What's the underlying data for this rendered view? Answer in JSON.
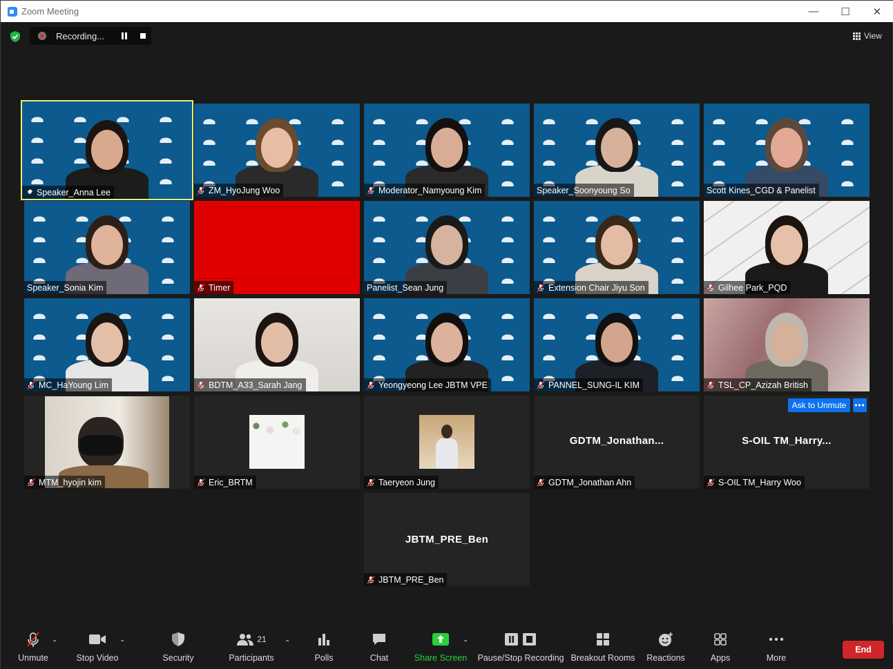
{
  "window": {
    "title": "Zoom Meeting"
  },
  "recording": {
    "label": "Recording..."
  },
  "view": {
    "label": "View"
  },
  "tiles": [
    {
      "name": "Speaker_Anna Lee",
      "bg": "pattern",
      "skin": "#d9a98d",
      "hair": "#1b1410",
      "shirt": "#1c1c1c",
      "active": true,
      "mic": "spotlight"
    },
    {
      "name": "ZM_HyoJung Woo",
      "bg": "pattern",
      "skin": "#e8bda5",
      "hair": "#6b4a30",
      "shirt": "#2a2a2a",
      "mic": "muted"
    },
    {
      "name": "Moderator_Namyoung Kim",
      "bg": "pattern",
      "skin": "#d8ad95",
      "hair": "#151010",
      "shirt": "#2a2a2a",
      "mic": "muted"
    },
    {
      "name": "Speaker_Soonyoung So",
      "bg": "pattern",
      "skin": "#d7b19a",
      "hair": "#181818",
      "shirt": "#d9d4c9",
      "mic": "none"
    },
    {
      "name": "Scott Kines_CGD & Panelist",
      "bg": "pattern",
      "skin": "#e3a994",
      "hair": "#5b4a3c",
      "shirt": "#344a66",
      "mic": "none"
    },
    {
      "name": "Speaker_Sonia Kim",
      "bg": "pattern",
      "skin": "#e0b49a",
      "hair": "#2b2018",
      "shirt": "#6e6a78",
      "mic": "none"
    },
    {
      "name": "Timer",
      "bg": "red",
      "mic": "muted"
    },
    {
      "name": "Panelist_Sean Jung",
      "bg": "pattern",
      "skin": "#d6b39e",
      "hair": "#1a1a1a",
      "shirt": "#3b3f45",
      "mic": "none"
    },
    {
      "name": "Extension Chair Jiyu Son",
      "bg": "pattern",
      "skin": "#e4bca4",
      "hair": "#3a2718",
      "shirt": "#d8d2c8",
      "mic": "muted"
    },
    {
      "name": "Gilhee Park_PQD",
      "bg": "white",
      "skin": "#e6c0aa",
      "hair": "#1b1410",
      "shirt": "#1a1a1a",
      "mic": "muted"
    },
    {
      "name": "MC_HaYoung Lim",
      "bg": "pattern",
      "skin": "#e4bfa7",
      "hair": "#1a1412",
      "shirt": "#e6e6e6",
      "mic": "muted"
    },
    {
      "name": "BDTM_A33_Sarah Jang",
      "bg": "room",
      "skin": "#e2bea6",
      "hair": "#1b1410",
      "shirt": "#f0eeea",
      "mic": "muted"
    },
    {
      "name": "Yeongyeong Lee JBTM VPE",
      "bg": "pattern",
      "skin": "#dcb29c",
      "hair": "#120e0d",
      "shirt": "#222222",
      "mic": "muted"
    },
    {
      "name": "PANNEL_SUNG-IL KIM",
      "bg": "pattern",
      "skin": "#d2a58c",
      "hair": "#111111",
      "shirt": "#1d2026",
      "mic": "muted"
    },
    {
      "name": "TSL_CP_Azizah British",
      "bg": "mall",
      "skin": "#d6b19a",
      "hair": "#bfb7ad",
      "shirt": "#6e6a60",
      "mic": "muted"
    },
    {
      "name": "MTM_hyojin kim",
      "bg": "thumb-big",
      "mic": "muted"
    },
    {
      "name": "Eric_BRTM",
      "bg": "thumb-flowers",
      "mic": "muted"
    },
    {
      "name": "Taeryeon Jung",
      "bg": "thumb-man",
      "mic": "muted"
    },
    {
      "name": "GDTM_Jonathan Ahn",
      "bg": "initials",
      "initials": "GDTM_Jonathan...",
      "mic": "muted"
    },
    {
      "name": "S-OIL TM_Harry Woo",
      "bg": "initials",
      "initials": "S-OIL TM_Harry...",
      "mic": "muted"
    },
    {
      "name": "JBTM_PRE_Ben",
      "bg": "initials",
      "initials": "JBTM_PRE_Ben",
      "mic": "muted"
    }
  ],
  "tile_actions": {
    "ask_to_unmute": "Ask to Unmute",
    "more": "•••"
  },
  "toolbar": {
    "unmute": "Unmute",
    "stop_video": "Stop Video",
    "security": "Security",
    "participants": "Participants",
    "participants_count": "21",
    "polls": "Polls",
    "chat": "Chat",
    "share_screen": "Share Screen",
    "pause_stop_recording": "Pause/Stop Recording",
    "breakout_rooms": "Breakout Rooms",
    "reactions": "Reactions",
    "apps": "Apps",
    "more": "More",
    "end": "End"
  },
  "colors": {
    "accent": "#0e72ed",
    "active_speaker": "#e3f07a",
    "end": "#d0262a",
    "share": "#2bd03c",
    "muted": "#e02828"
  }
}
